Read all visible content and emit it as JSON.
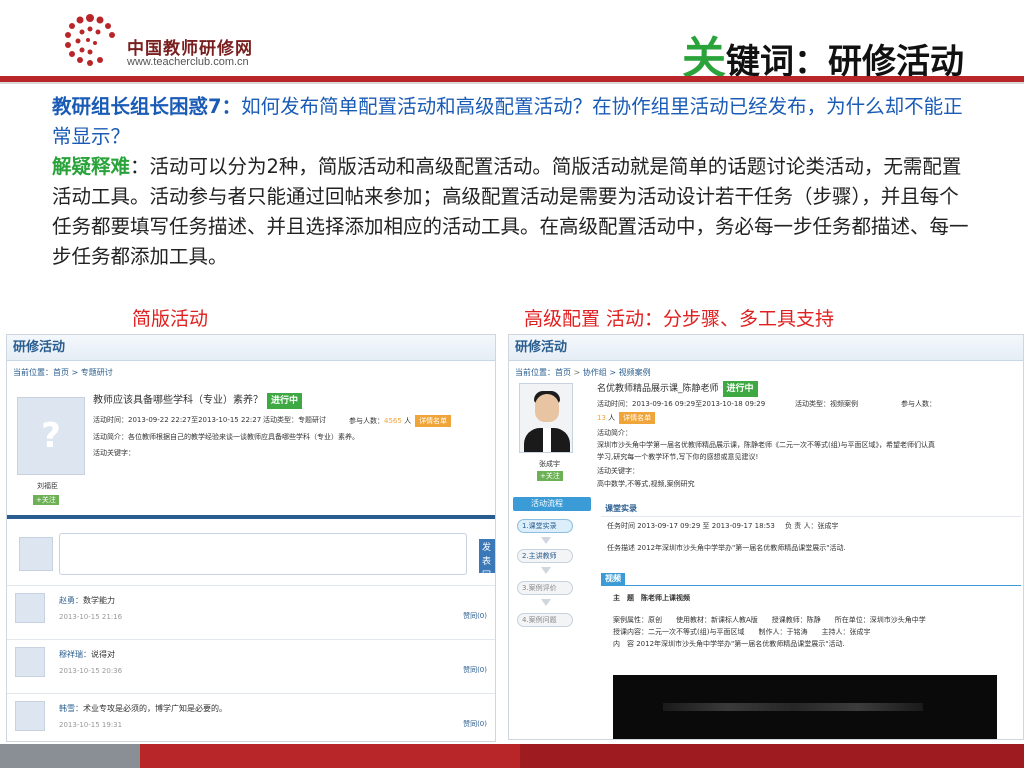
{
  "header": {
    "logo_name": "中国教师研修网",
    "logo_url": "www.teacherclub.com.cn",
    "keyword_first_char": "关",
    "keyword_rest": "键词：研修活动"
  },
  "question": {
    "label": "教研组长组长困惑7：",
    "text": "如何发布简单配置活动和高级配置活动？在协作组里活动已经发布，为什么却不能正常显示？"
  },
  "answer": {
    "label": "解疑释难",
    "text": "：活动可以分为2种，简版活动和高级配置活动。简版活动就是简单的话题讨论类活动，无需配置活动工具。活动参与者只能通过回帖来参加；高级配置活动是需要为活动设计若干任务（步骤），并且每个任务都要填写任务描述、并且选择添加相应的活动工具。在高级配置活动中，务必每一步任务都描述、每一步任务都添加工具。"
  },
  "captions": {
    "left": "简版活动",
    "right": "高级配置 活动：分步骤、多工具支持"
  },
  "left_shot": {
    "page_title": "研修活动",
    "crumb_prefix": "当前位置：",
    "crumb_home": "首页",
    "crumb_sep": " > ",
    "crumb_current": "专题研讨",
    "topic_title": "教师应该具备哪些学科（专业）素养？",
    "status": "进行中",
    "time_line": "活动时间：2013-09-22 22:27至2013-10-15 22:27",
    "type_line": "活动类型：专题研讨",
    "join_label": "参与人数：",
    "join_count": "4565",
    "join_unit": "人",
    "detail_btn": "详情名单",
    "intro_line": "活动简介：各位教师根据自己的教学经验来谈一谈教师应具备哪些学科（专业）素养。",
    "keyword_line": "活动关键字：",
    "author": "刘福臣",
    "follow": "+关注",
    "publish_btn": "发表回复",
    "comments": [
      {
        "name": "赵勇：",
        "text": "数学能力",
        "time": "2013-10-15 21:16",
        "like": "赞同(0)"
      },
      {
        "name": "穆祥瑞：",
        "text": "说得对",
        "time": "2013-10-15 20:36",
        "like": "赞同(0)"
      },
      {
        "name": "韩雪：",
        "text": "术业专攻是必须的，博学广知是必要的。",
        "time": "2013-10-15 19:31",
        "like": "赞同(0)"
      }
    ]
  },
  "right_shot": {
    "page_title": "研修活动",
    "crumb_prefix": "当前位置：",
    "crumb_home": "首页",
    "crumb_group": "协作组",
    "crumb_current": "视频案例",
    "activity_title": "名优教师精品展示课_陈静老师",
    "status": "进行中",
    "time_line": "活动时间：2013-09-16 09:29至2013-10-18 09:29",
    "type_line": "活动类型：视频案例",
    "join_label": "参与人数：",
    "join_count": "13",
    "join_unit": "人",
    "detail_btn": "详情名单",
    "intro_label": "活动简介：",
    "intro_text_1": "深圳市沙头角中学第一届名优教师精品展示课，陈静老师《二元一次不等式(组)与平面区域》，希望老师们认真",
    "intro_text_2": "学习,研究每一个教学环节,写下你的感想或意见建议!",
    "keyword_label": "活动关键字：",
    "keywords": "高中数学,不等式,视频,案例研究",
    "teacher_name": "张成宇",
    "follow": "+关注",
    "flow_title": "活动流程",
    "steps": [
      "1.课堂实录",
      "2.主讲教师",
      "3.案例评价",
      "4.案例问题"
    ],
    "section_title": "课堂实录",
    "task_time": "任务时间 2013-09-17 09:29 至 2013-09-17 18:53",
    "owner": "负 责 人：张成宇",
    "task_desc": "任务描述 2012年深圳市沙头角中学举办\"第一届名优教师精品课堂展示\"活动.",
    "video_tab": "视频",
    "video_title_label": "主　题",
    "video_title": "陈老师上课视频",
    "row1": "案例属性：原创　　使用教材：新课标人教A版　　授课教师：陈静　　所在单位：深圳市沙头角中学",
    "row2": "授课内容：二元一次不等式(组)与平面区域　　制作人：于铭涛　　主持人：张成宇",
    "row3": "内　容 2012年深圳市沙头角中学举办\"第一届名优教师精品课堂展示\"活动."
  },
  "colors": {
    "accent_red": "#b8262a",
    "question_blue": "#1a5bb5",
    "answer_green": "#2aa33a",
    "caption_red": "#e02020"
  }
}
